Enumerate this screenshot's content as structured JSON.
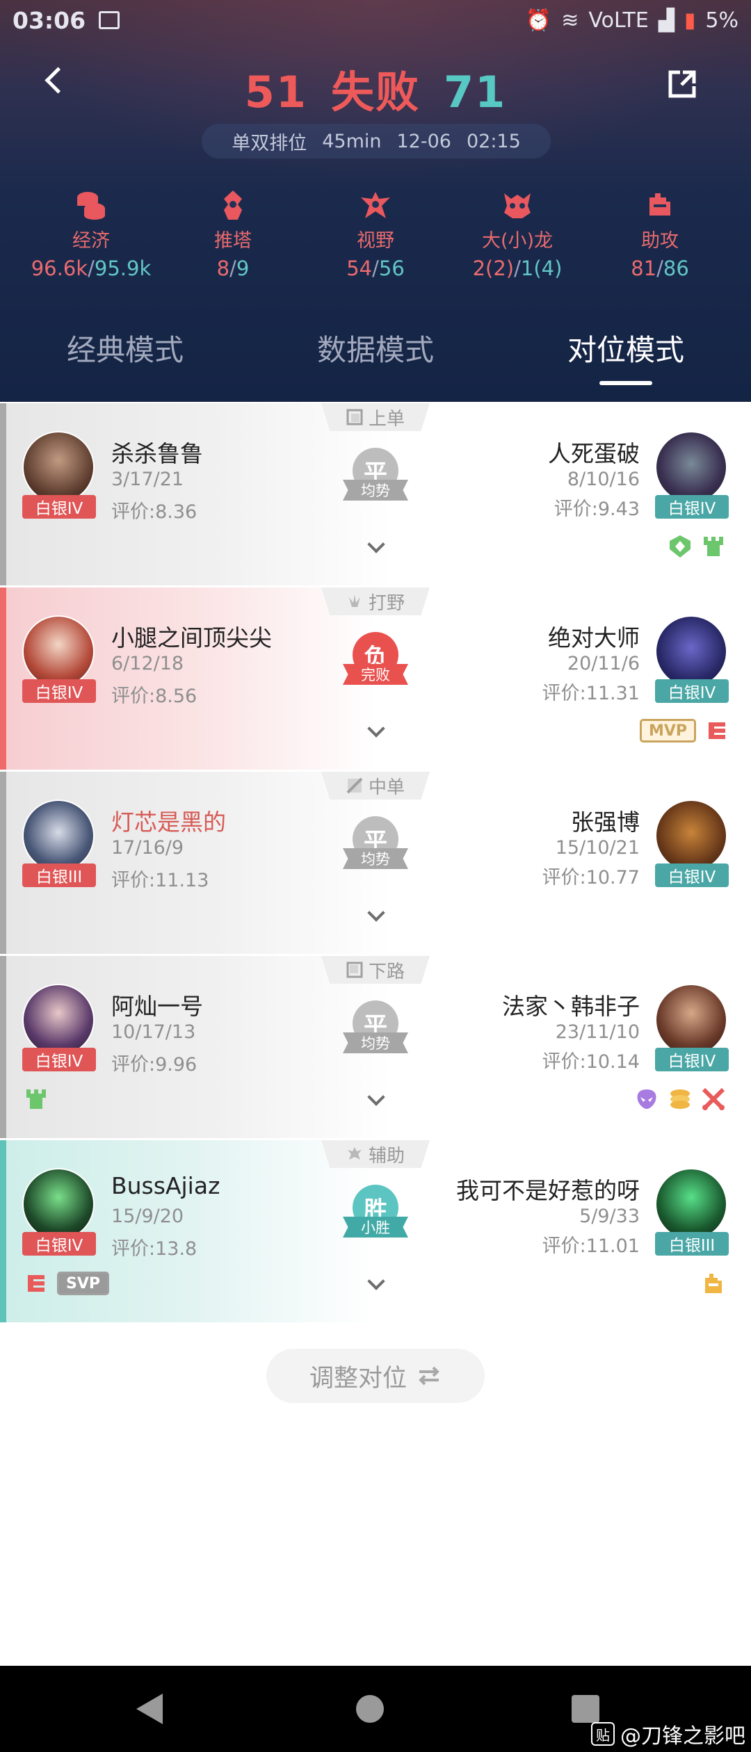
{
  "status_bar": {
    "time": "03:06",
    "signal_text": "VoLTE",
    "battery": "5%"
  },
  "header": {
    "left_score": "51",
    "result": "失败",
    "right_score": "71",
    "meta": {
      "mode": "单双排位",
      "duration": "45min",
      "date": "12-06",
      "time": "02:15"
    },
    "colors": {
      "red": "#ee5a5a",
      "teal": "#58c8c4"
    }
  },
  "stats": [
    {
      "icon": "coins-icon",
      "label": "经济",
      "left": "96.6k",
      "right": "95.9k"
    },
    {
      "icon": "tower-icon",
      "label": "推塔",
      "left": "8",
      "right": "9"
    },
    {
      "icon": "ward-icon",
      "label": "视野",
      "left": "54",
      "right": "56"
    },
    {
      "icon": "dragon-icon",
      "label": "大(小)龙",
      "left": "2(2)",
      "right": "1(4)"
    },
    {
      "icon": "fist-icon",
      "label": "助攻",
      "left": "81",
      "right": "86"
    }
  ],
  "tabs": [
    {
      "label": "经典模式",
      "active": false
    },
    {
      "label": "数据模式",
      "active": false
    },
    {
      "label": "对位模式",
      "active": true
    }
  ],
  "rows": [
    {
      "lane": "上单",
      "lane_icon": "top-lane-icon",
      "verdict": "平",
      "verdict_sub": "均势",
      "verdict_color": "gray",
      "left": {
        "name": "杀杀鲁鲁",
        "kda": "3/17/21",
        "score": "评价:8.36",
        "rank": "白银IV"
      },
      "right": {
        "name": "人死蛋破",
        "kda": "8/10/16",
        "score": "评价:9.43",
        "rank": "白银IV"
      }
    },
    {
      "lane": "打野",
      "lane_icon": "jungle-icon",
      "verdict": "负",
      "verdict_sub": "完败",
      "verdict_color": "red",
      "left": {
        "name": "小腿之间顶尖尖",
        "kda": "6/12/18",
        "score": "评价:8.56",
        "rank": "白银IV"
      },
      "right": {
        "name": "绝对大师",
        "kda": "20/11/6",
        "score": "评价:11.31",
        "rank": "白银IV",
        "badge": "MVP"
      }
    },
    {
      "lane": "中单",
      "lane_icon": "mid-lane-icon",
      "verdict": "平",
      "verdict_sub": "均势",
      "verdict_color": "gray",
      "left": {
        "name": "灯芯是黑的",
        "kda": "17/16/9",
        "score": "评价:11.13",
        "rank": "白银III"
      },
      "right": {
        "name": "张强博",
        "kda": "15/10/21",
        "score": "评价:10.77",
        "rank": "白银IV"
      }
    },
    {
      "lane": "下路",
      "lane_icon": "bot-lane-icon",
      "verdict": "平",
      "verdict_sub": "均势",
      "verdict_color": "gray",
      "left": {
        "name": "阿灿一号",
        "kda": "10/17/13",
        "score": "评价:9.96",
        "rank": "白银IV"
      },
      "right": {
        "name": "法家丶韩非子",
        "kda": "23/11/10",
        "score": "评价:10.14",
        "rank": "白银IV"
      }
    },
    {
      "lane": "辅助",
      "lane_icon": "support-icon",
      "verdict": "胜",
      "verdict_sub": "小胜",
      "verdict_color": "teal",
      "left": {
        "name": "BussAjiaz",
        "kda": "15/9/20",
        "score": "评价:13.8",
        "rank": "白银IV",
        "badge": "SVP"
      },
      "right": {
        "name": "我可不是好惹的呀",
        "kda": "5/9/33",
        "score": "评价:11.01",
        "rank": "白银III"
      }
    }
  ],
  "adjust_button": {
    "label": "调整对位"
  },
  "watermark": {
    "badge": "贴",
    "text": "@刀锋之影吧"
  }
}
